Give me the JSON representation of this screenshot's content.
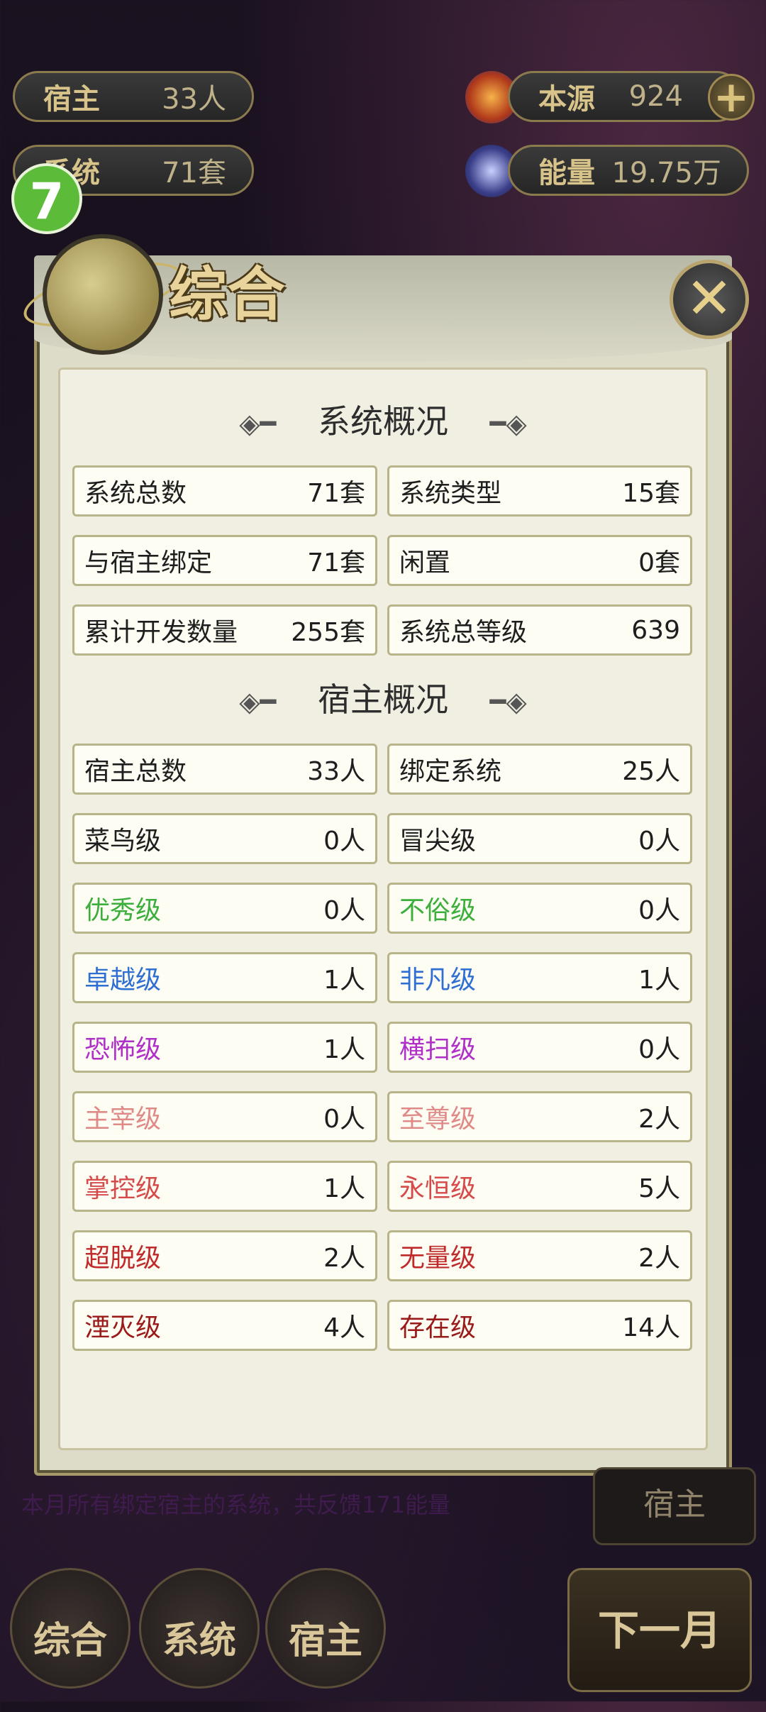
{
  "top_stats": {
    "hosts": {
      "label": "宿主",
      "value": "33人"
    },
    "systems": {
      "label": "系统",
      "value": "71套"
    },
    "origin": {
      "label": "本源",
      "value": "924"
    },
    "energy": {
      "label": "能量",
      "value": "19.75万"
    }
  },
  "badge": "7",
  "dialog": {
    "title": "综合",
    "close_icon": "close-icon",
    "system_section": {
      "title": "系统概况",
      "rows": [
        [
          {
            "label": "系统总数",
            "value": "71套"
          },
          {
            "label": "系统类型",
            "value": "15套"
          }
        ],
        [
          {
            "label": "与宿主绑定",
            "value": "71套"
          },
          {
            "label": "闲置",
            "value": "0套"
          }
        ],
        [
          {
            "label": "累计开发数量",
            "value": "255套"
          },
          {
            "label": "系统总等级",
            "value": "639"
          }
        ]
      ]
    },
    "host_section": {
      "title": "宿主概况",
      "rows": [
        [
          {
            "label": "宿主总数",
            "value": "33人",
            "color": "#1e1e1e"
          },
          {
            "label": "绑定系统",
            "value": "25人",
            "color": "#1e1e1e"
          }
        ],
        [
          {
            "label": "菜鸟级",
            "value": "0人",
            "color": "#1e1e1e"
          },
          {
            "label": "冒尖级",
            "value": "0人",
            "color": "#1e1e1e"
          }
        ],
        [
          {
            "label": "优秀级",
            "value": "0人",
            "color": "#3cae3c"
          },
          {
            "label": "不俗级",
            "value": "0人",
            "color": "#3cae3c"
          }
        ],
        [
          {
            "label": "卓越级",
            "value": "1人",
            "color": "#2f6fd4"
          },
          {
            "label": "非凡级",
            "value": "1人",
            "color": "#2f6fd4"
          }
        ],
        [
          {
            "label": "恐怖级",
            "value": "1人",
            "color": "#b02fc8"
          },
          {
            "label": "横扫级",
            "value": "0人",
            "color": "#b02fc8"
          }
        ],
        [
          {
            "label": "主宰级",
            "value": "0人",
            "color": "#e08a88"
          },
          {
            "label": "至尊级",
            "value": "2人",
            "color": "#e08a88"
          }
        ],
        [
          {
            "label": "掌控级",
            "value": "1人",
            "color": "#d64a4a"
          },
          {
            "label": "永恒级",
            "value": "5人",
            "color": "#d64a4a"
          }
        ],
        [
          {
            "label": "超脱级",
            "value": "2人",
            "color": "#c02a2a"
          },
          {
            "label": "无量级",
            "value": "2人",
            "color": "#c02a2a"
          }
        ],
        [
          {
            "label": "湮灭级",
            "value": "4人",
            "color": "#9a1a1a"
          },
          {
            "label": "存在级",
            "value": "14人",
            "color": "#9a1a1a"
          }
        ]
      ]
    }
  },
  "footer_message": "本月所有绑定宿主的系统，共反馈171能量",
  "bottom_tabs": [
    "综合",
    "系统",
    "宿主"
  ],
  "seek_host": "宿主",
  "next_month": "下一月"
}
